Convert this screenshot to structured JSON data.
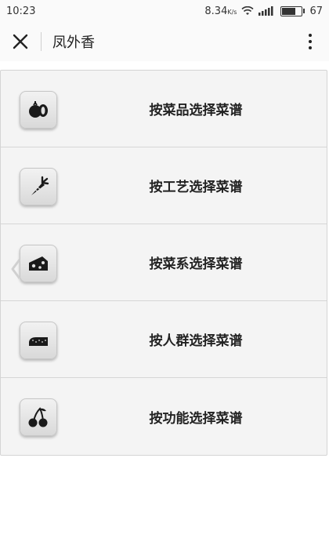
{
  "status_bar": {
    "time": "10:23",
    "network_speed": "8.34",
    "network_unit": "K/s",
    "battery": "67"
  },
  "header": {
    "title": "凤外香",
    "close_icon": "close-icon",
    "more_icon": "more-vertical-icon"
  },
  "menu": {
    "items": [
      {
        "label": "按菜品选择菜谱",
        "icon": "tomato-icon"
      },
      {
        "label": "按工艺选择菜谱",
        "icon": "carrot-icon"
      },
      {
        "label": "按菜系选择菜谱",
        "icon": "cheese-icon"
      },
      {
        "label": "按人群选择菜谱",
        "icon": "bread-icon"
      },
      {
        "label": "按功能选择菜谱",
        "icon": "cherry-icon"
      }
    ]
  }
}
